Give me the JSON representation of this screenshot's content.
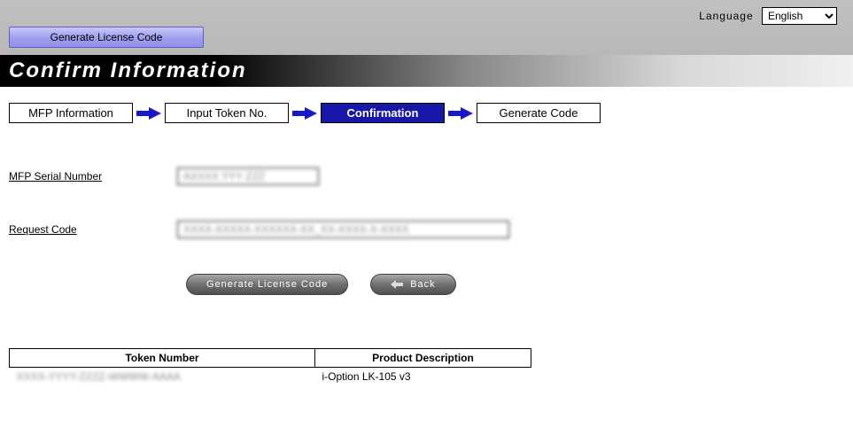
{
  "header": {
    "language_label": "Language",
    "language_value": "English",
    "nav_button": "Generate License Code",
    "page_title": "Confirm Information"
  },
  "steps": [
    {
      "label": "MFP Information",
      "active": false
    },
    {
      "label": "Input Token No.",
      "active": false
    },
    {
      "label": "Confirmation",
      "active": true
    },
    {
      "label": "Generate Code",
      "active": false
    }
  ],
  "form": {
    "serial_label": "MFP Serial Number",
    "serial_value": "AXXXX YYY ZZZ",
    "request_label": "Request Code",
    "request_value": "XXXX-XXXXX-XXXXXX-XX_XX-XXXX-X-XXXX"
  },
  "buttons": {
    "generate": "Generate License Code",
    "back": "Back"
  },
  "table": {
    "header_token": "Token Number",
    "header_product": "Product Description",
    "rows": [
      {
        "token": "XXXX-YYYY-ZZZZ-WWWW-AAAA",
        "product": "i-Option LK-105 v3"
      }
    ]
  }
}
